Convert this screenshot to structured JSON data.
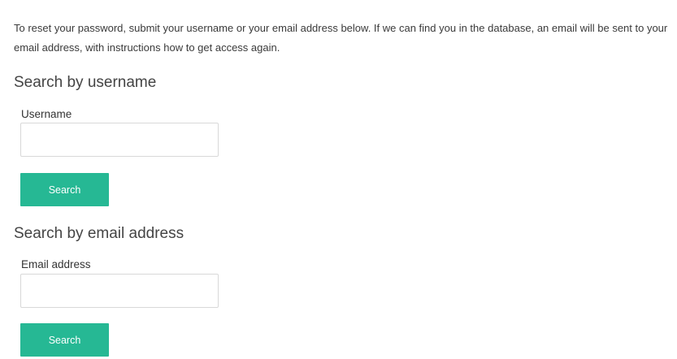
{
  "intro": {
    "text": "To reset your password, submit your username or your email address below. If we can find you in the database, an email will be sent to your email address, with instructions how to get access again."
  },
  "username_section": {
    "heading": "Search by username",
    "field_label": "Username",
    "input_value": "",
    "button_label": "Search"
  },
  "email_section": {
    "heading": "Search by email address",
    "field_label": "Email address",
    "input_value": "",
    "button_label": "Search"
  },
  "colors": {
    "button_bg": "#26b894",
    "button_text": "#ffffff",
    "input_border": "#d8d8d8"
  }
}
